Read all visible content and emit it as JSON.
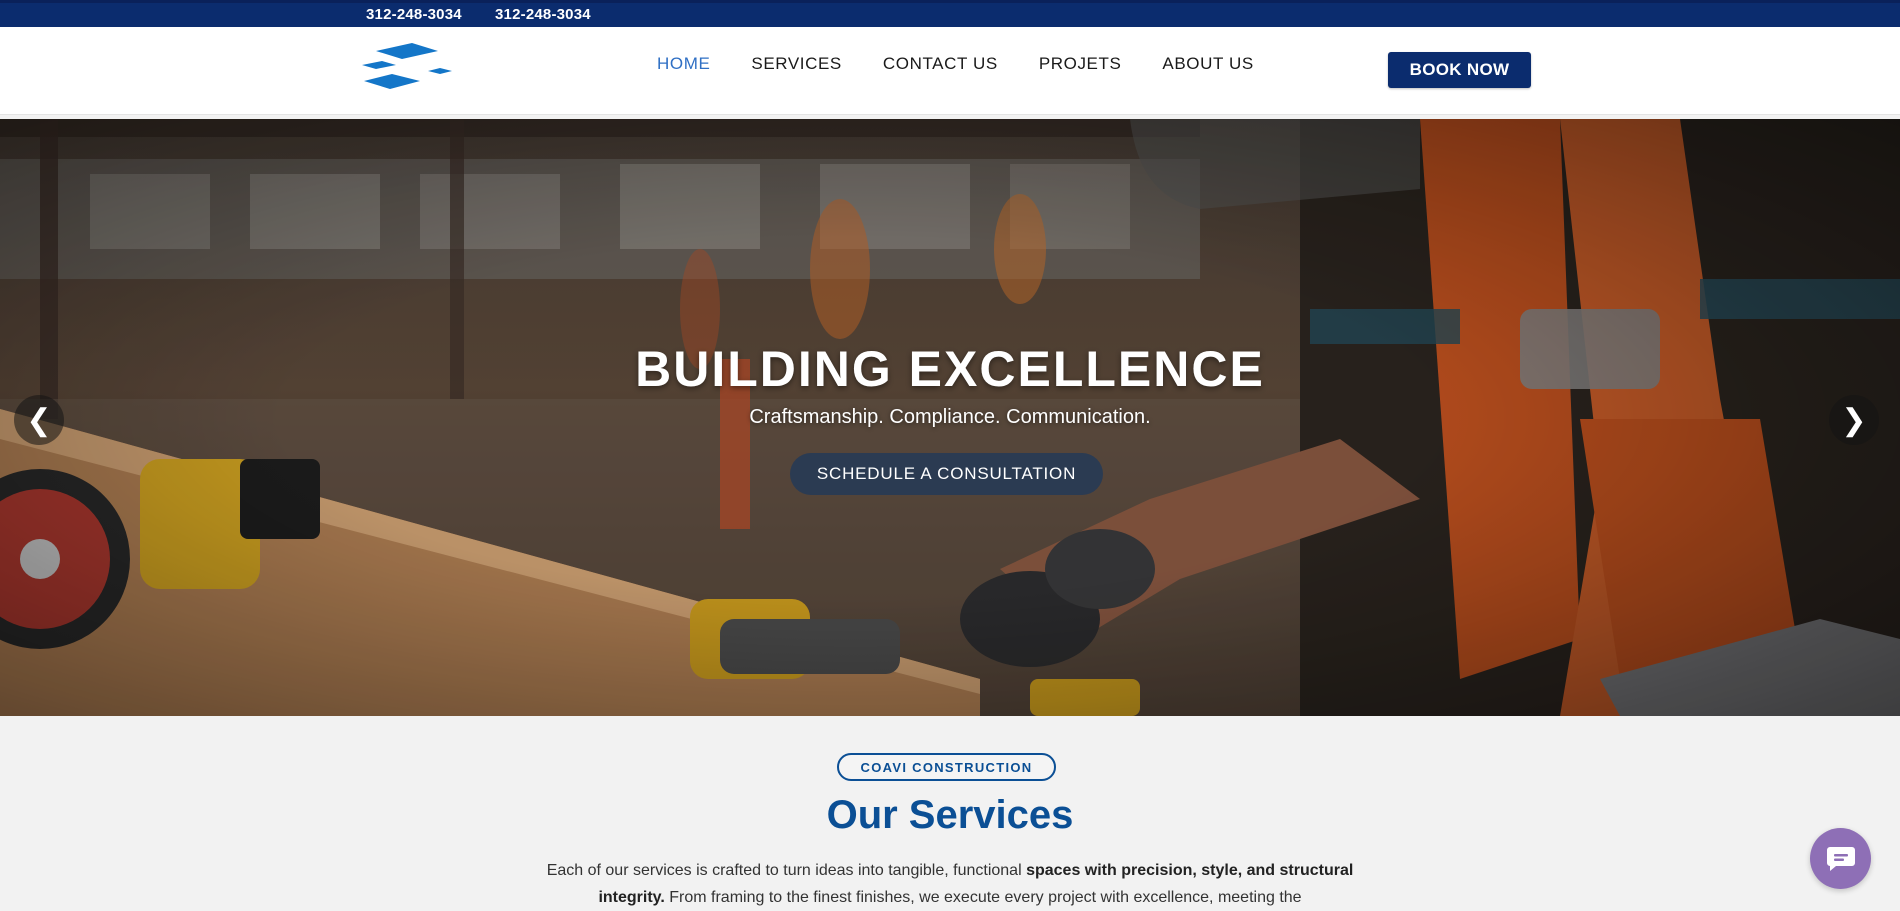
{
  "topbar": {
    "phone_1": "312-248-3034",
    "phone_2": "312-248-3034"
  },
  "header": {
    "logo_icon": "diamond-tiles-logo",
    "nav": [
      {
        "label": "HOME",
        "active": true
      },
      {
        "label": "SERVICES",
        "active": false
      },
      {
        "label": "CONTACT US",
        "active": false
      },
      {
        "label": "PROJETS",
        "active": false
      },
      {
        "label": "ABOUT US",
        "active": false
      }
    ],
    "book_label": "BOOK NOW"
  },
  "hero": {
    "title": "BUILDING EXCELLENCE",
    "subtitle": "Craftsmanship. Compliance. Communication.",
    "cta_label": "SCHEDULE A CONSULTATION",
    "prev_glyph": "❮",
    "next_glyph": "❯"
  },
  "services": {
    "badge": "COAVI CONSTRUCTION",
    "title": "Our Services",
    "text_part1": "Each of our services is crafted to turn ideas into tangible, functional ",
    "text_bold": "spaces with precision, style, and structural integrity.",
    "text_part2": " From framing to the finest finishes, we execute every project with excellence, meeting the"
  },
  "chat": {
    "icon": "chat-bubble-icon"
  },
  "colors": {
    "brand_navy": "#0b2c6e",
    "brand_blue": "#0b4f95",
    "nav_active": "#2f6fc4",
    "chat_purple": "#8e6fb6"
  }
}
